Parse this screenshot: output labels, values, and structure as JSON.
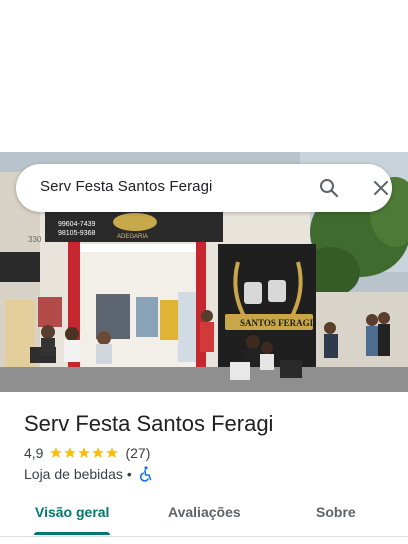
{
  "search": {
    "query": "Serv Festa Santos Feragi"
  },
  "photo": {
    "sign_phone_1": "99604-7439",
    "sign_phone_2": "98105-9368",
    "sign_label": "ADEGARIA",
    "logo_text": "SANTOS FERAGI",
    "house_number": "330"
  },
  "place": {
    "name": "Serv Festa Santos Feragi",
    "rating": "4,9",
    "stars": 5,
    "reviews": "(27)",
    "category": "Loja de bebidas",
    "separator": "•"
  },
  "tabs": [
    {
      "label": "Visão geral",
      "active": true
    },
    {
      "label": "Avaliações",
      "active": false
    },
    {
      "label": "Sobre",
      "active": false
    }
  ],
  "colors": {
    "accent": "#01786f",
    "star": "#fbbc04",
    "wheelchair": "#1a73e8"
  }
}
